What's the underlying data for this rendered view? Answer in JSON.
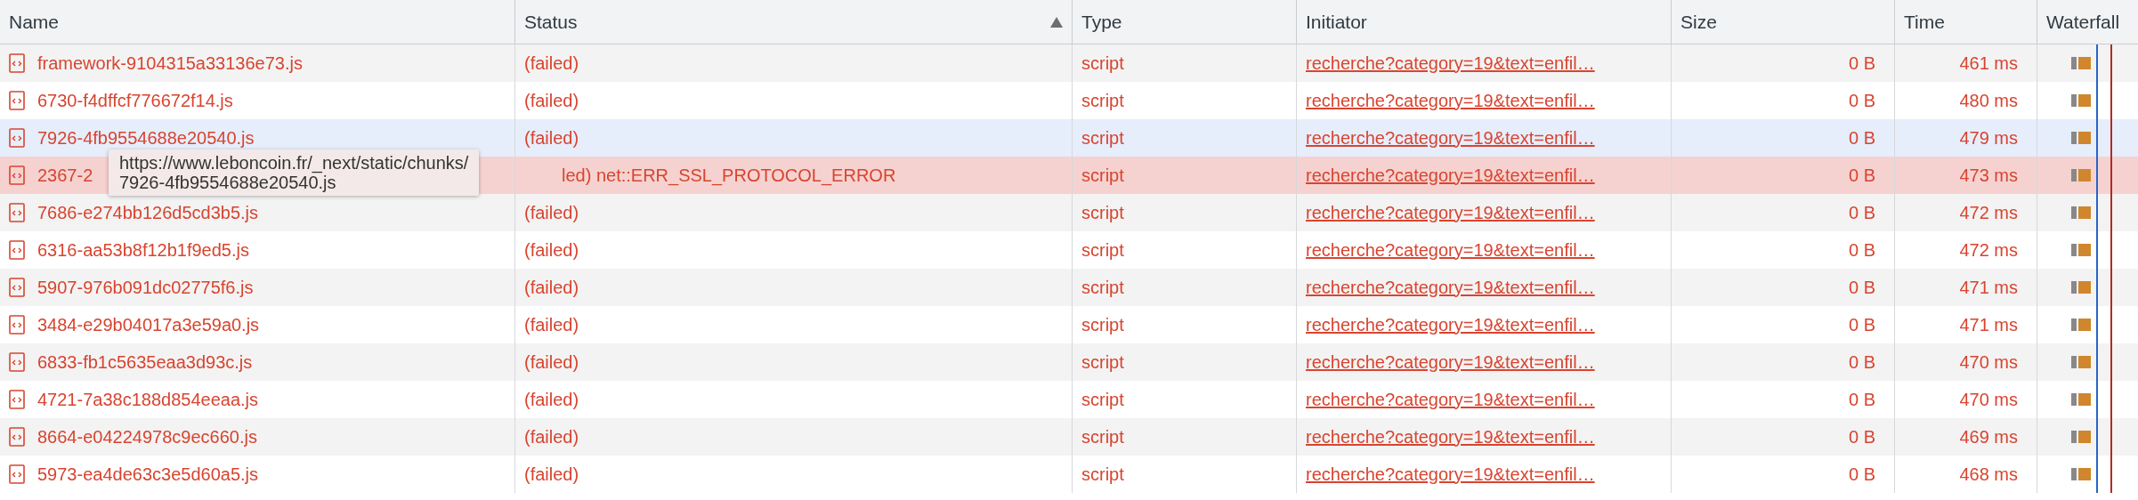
{
  "columns": [
    {
      "label": "Name",
      "sorted": false
    },
    {
      "label": "Status",
      "sorted": true
    },
    {
      "label": "Type",
      "sorted": false
    },
    {
      "label": "Initiator",
      "sorted": false
    },
    {
      "label": "Size",
      "sorted": false
    },
    {
      "label": "Time",
      "sorted": false
    },
    {
      "label": "Waterfall",
      "sorted": false
    }
  ],
  "rows": [
    {
      "name": "framework-9104315a33136e73.js",
      "status": "(failed)",
      "type": "script",
      "initiator": "recherche?category=19&text=enfil…",
      "size": "0 B",
      "time": "461 ms",
      "hovered": false,
      "selected": false
    },
    {
      "name": "6730-f4dffcf776672f14.js",
      "status": "(failed)",
      "type": "script",
      "initiator": "recherche?category=19&text=enfil…",
      "size": "0 B",
      "time": "480 ms",
      "hovered": false,
      "selected": false
    },
    {
      "name": "7926-4fb9554688e20540.js",
      "status": "(failed)",
      "type": "script",
      "initiator": "recherche?category=19&text=enfil…",
      "size": "0 B",
      "time": "479 ms",
      "hovered": true,
      "selected": false
    },
    {
      "name": "2367-2",
      "status": "led) net::ERR_SSL_PROTOCOL_ERROR",
      "type": "script",
      "initiator": "recherche?category=19&text=enfil…",
      "size": "0 B",
      "time": "473 ms",
      "hovered": false,
      "selected": true
    },
    {
      "name": "7686-e274bb126d5cd3b5.js",
      "status": "(failed)",
      "type": "script",
      "initiator": "recherche?category=19&text=enfil…",
      "size": "0 B",
      "time": "472 ms",
      "hovered": false,
      "selected": false
    },
    {
      "name": "6316-aa53b8f12b1f9ed5.js",
      "status": "(failed)",
      "type": "script",
      "initiator": "recherche?category=19&text=enfil…",
      "size": "0 B",
      "time": "472 ms",
      "hovered": false,
      "selected": false
    },
    {
      "name": "5907-976b091dc02775f6.js",
      "status": "(failed)",
      "type": "script",
      "initiator": "recherche?category=19&text=enfil…",
      "size": "0 B",
      "time": "471 ms",
      "hovered": false,
      "selected": false
    },
    {
      "name": "3484-e29b04017a3e59a0.js",
      "status": "(failed)",
      "type": "script",
      "initiator": "recherche?category=19&text=enfil…",
      "size": "0 B",
      "time": "471 ms",
      "hovered": false,
      "selected": false
    },
    {
      "name": "6833-fb1c5635eaa3d93c.js",
      "status": "(failed)",
      "type": "script",
      "initiator": "recherche?category=19&text=enfil…",
      "size": "0 B",
      "time": "470 ms",
      "hovered": false,
      "selected": false
    },
    {
      "name": "4721-7a38c188d854eeaa.js",
      "status": "(failed)",
      "type": "script",
      "initiator": "recherche?category=19&text=enfil…",
      "size": "0 B",
      "time": "470 ms",
      "hovered": false,
      "selected": false
    },
    {
      "name": "8664-e04224978c9ec660.js",
      "status": "(failed)",
      "type": "script",
      "initiator": "recherche?category=19&text=enfil…",
      "size": "0 B",
      "time": "469 ms",
      "hovered": false,
      "selected": false
    },
    {
      "name": "5973-ea4de63c3e5d60a5.js",
      "status": "(failed)",
      "type": "script",
      "initiator": "recherche?category=19&text=enfil…",
      "size": "0 B",
      "time": "468 ms",
      "hovered": false,
      "selected": false
    }
  ],
  "tooltip": {
    "lines": [
      "https://www.leboncoin.fr/_next/static/chunks/",
      "7926-4fb9554688e20540.js"
    ]
  }
}
